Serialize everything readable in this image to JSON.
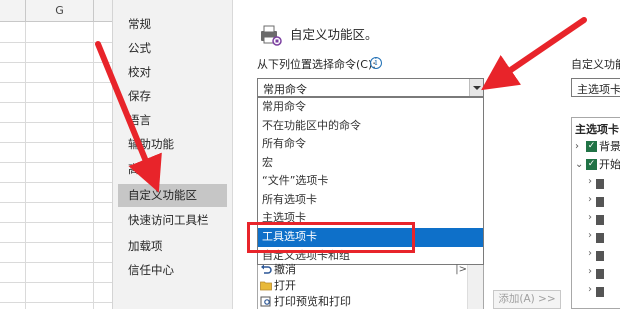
{
  "sheet": {
    "column_label": "G"
  },
  "nav": {
    "items": [
      "常规",
      "公式",
      "校对",
      "保存",
      "语言",
      "辅助功能",
      "高级",
      "自定义功能区",
      "快速访问工具栏",
      "加载项",
      "信任中心"
    ],
    "selected_index": 7
  },
  "main": {
    "title": "自定义功能区。",
    "choose_commands_label": "从下列位置选择命令(C):",
    "info_icon": "i",
    "combo_value": "常用命令",
    "dropdown_options": [
      "常用命令",
      "不在功能区中的命令",
      "所有命令",
      "宏",
      "“文件”选项卡",
      "所有选项卡",
      "主选项卡",
      "工具选项卡",
      "自定义选项卡和组"
    ],
    "highlighted_option_index": 7,
    "list_items": [
      {
        "label": "撤消",
        "icon": "undo-icon"
      },
      {
        "label": "打开",
        "icon": "folder-icon"
      },
      {
        "label": "打印预览和打印",
        "icon": "print-preview-icon"
      }
    ],
    "add_button": "添加(A) >>"
  },
  "right": {
    "customize_label": "自定义功能",
    "combo_value": "主选项卡",
    "tree_header": "主选项卡",
    "tree_items": [
      {
        "label": "背景",
        "expanded": false,
        "checked": true
      },
      {
        "label": "开始",
        "expanded": true,
        "checked": true
      }
    ]
  },
  "colors": {
    "highlight": "#0e70c9",
    "annotation": "#e8242a",
    "checkbox": "#217346"
  }
}
